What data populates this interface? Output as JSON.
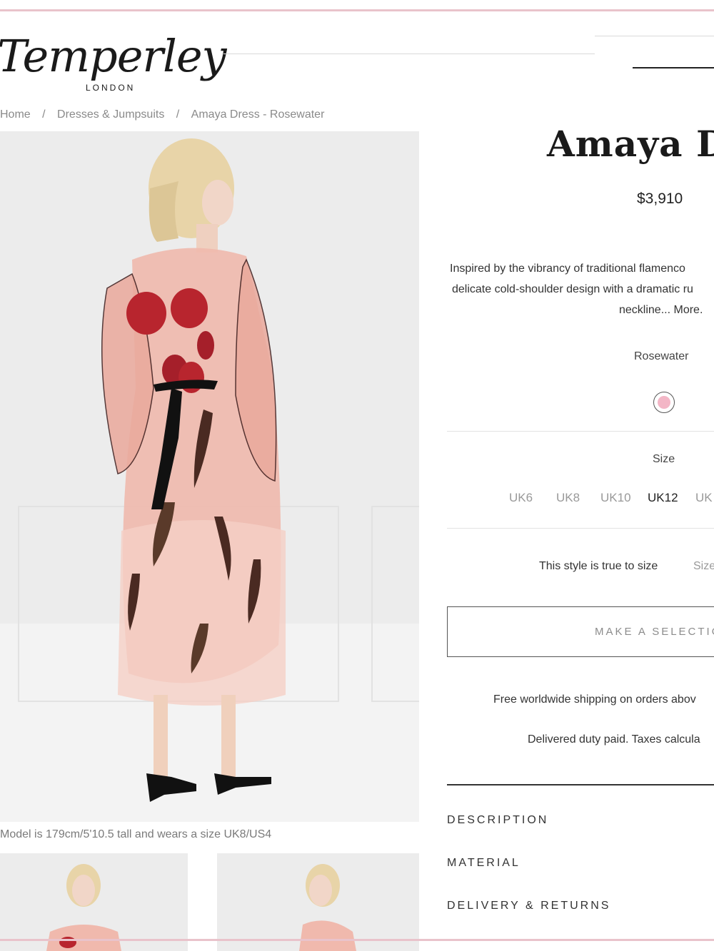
{
  "brand": {
    "name": "Temperley",
    "sub": "LONDON"
  },
  "breadcrumb": [
    {
      "label": "Home"
    },
    {
      "label": "Dresses & Jumpsuits"
    },
    {
      "label": "Amaya Dress - Rosewater"
    }
  ],
  "breadcrumb_separator": "/",
  "gallery": {
    "caption": "Model is 179cm/5'10.5 tall and wears a size UK8/US4"
  },
  "product": {
    "title": "Amaya Dr",
    "price": "$3,910",
    "description": [
      "Inspired by the vibrancy of traditional flamenco",
      "delicate cold-shoulder design with a dramatic ru",
      "neckline... More."
    ],
    "colour": {
      "name": "Rosewater",
      "swatch": "#f3b6c6"
    },
    "size_label": "Size",
    "sizes": [
      {
        "label": "UK6",
        "selected": false
      },
      {
        "label": "UK8",
        "selected": false
      },
      {
        "label": "UK10",
        "selected": false
      },
      {
        "label": "UK12",
        "selected": true
      },
      {
        "label": "UK",
        "selected": false
      }
    ],
    "fit_note": "This style is true to size",
    "size_guide": "Size",
    "select_button": "MAKE A SELECTIO",
    "shipping": [
      "Free worldwide shipping on orders abov",
      "Delivered duty paid. Taxes calcula"
    ],
    "accordion": [
      "DESCRIPTION",
      "MATERIAL",
      "DELIVERY & RETURNS"
    ]
  },
  "colors": {
    "accent_rule": "#e9c3cb",
    "dress_pink": "#f0b9ad"
  }
}
